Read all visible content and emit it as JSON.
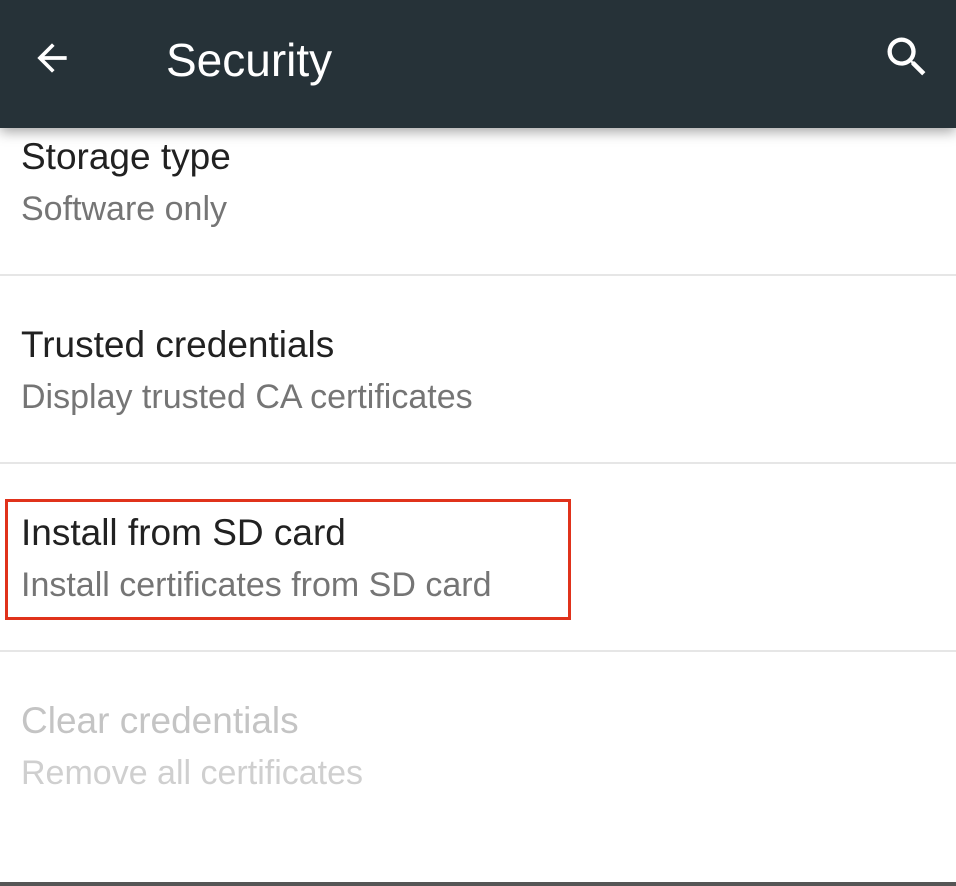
{
  "toolbar": {
    "title": "Security",
    "back_icon": "arrow-back-icon",
    "search_icon": "search-icon",
    "background_color": "#263238"
  },
  "preferences": [
    {
      "title": "Storage type",
      "summary": "Software only",
      "enabled": true
    },
    {
      "title": "Trusted credentials",
      "summary": "Display trusted CA certificates",
      "enabled": true
    },
    {
      "title": "Install from SD card",
      "summary": "Install certificates from SD card",
      "enabled": true,
      "highlighted": true
    },
    {
      "title": "Clear credentials",
      "summary": "Remove all certificates",
      "enabled": false
    }
  ],
  "highlight_color": "#e0321b"
}
